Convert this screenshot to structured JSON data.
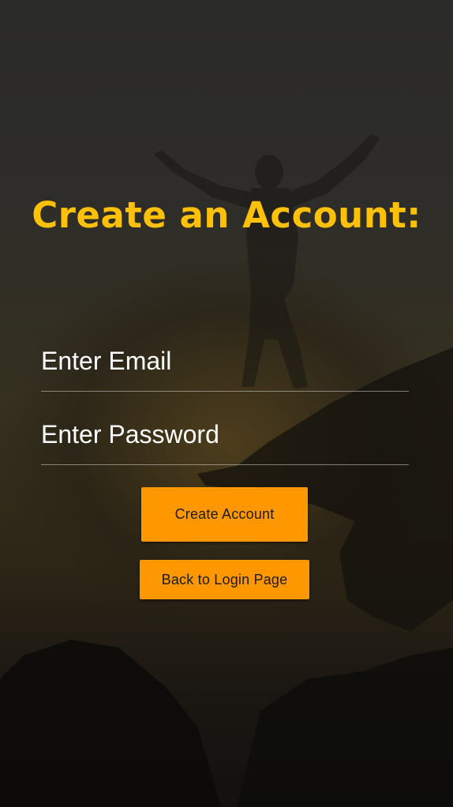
{
  "page": {
    "title": "Create an Account:"
  },
  "form": {
    "email_placeholder": "Enter Email",
    "password_placeholder": "Enter Password"
  },
  "buttons": {
    "create_label": "Create Account",
    "back_label": "Back to Login Page"
  },
  "colors": {
    "title": "#ffc107",
    "button": "#ff9800",
    "button_text": "#1b1b1b",
    "input_text": "#ffffff"
  },
  "icons": {
    "background": "person-on-cliff-silhouette-image"
  }
}
